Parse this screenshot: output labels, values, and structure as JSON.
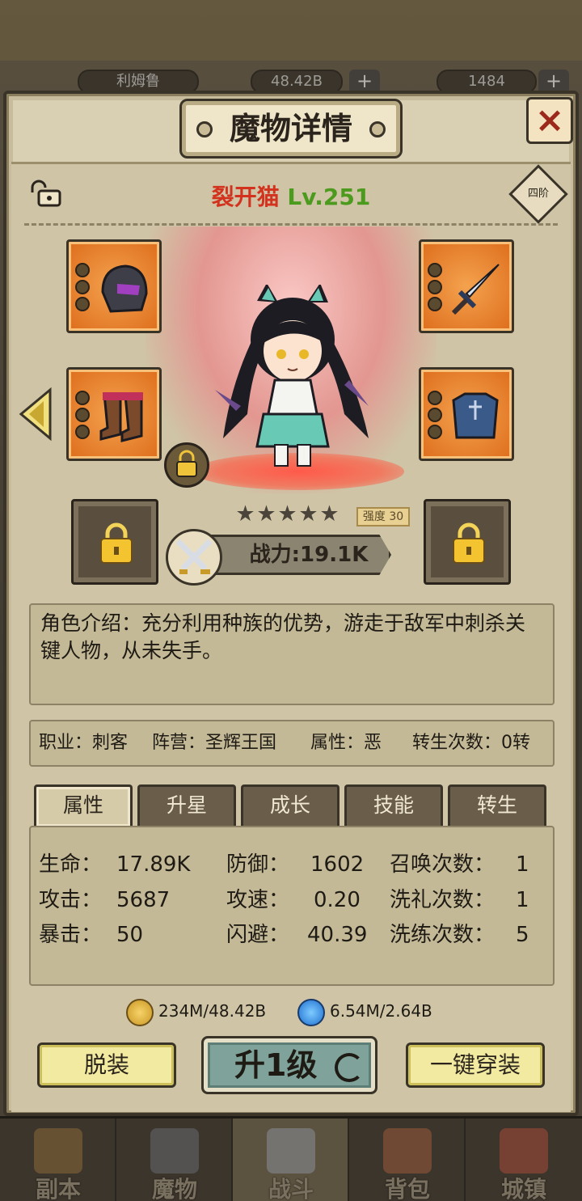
{
  "resources": {
    "player_name": "利姆鲁",
    "gold": "48.42B",
    "gems": "1484",
    "plus": "+"
  },
  "panel": {
    "title": "魔物详情",
    "close": "×"
  },
  "monster": {
    "name": "裂开猫",
    "level": "Lv.251",
    "tier": "四阶",
    "stars": 5,
    "strength_label": "强度",
    "strength_value": "30",
    "power": "战力:19.1K",
    "intro": "角色介绍：充分利用种族的优势，游走于敌军中刺杀关键人物，从未失手。"
  },
  "info": {
    "job": "职业：刺客",
    "camp": "阵营：圣辉王国",
    "attr": "属性：恶",
    "rebirth": "转生次数：0转"
  },
  "tabs": [
    {
      "label": "属性",
      "active": true
    },
    {
      "label": "升星",
      "active": false
    },
    {
      "label": "成长",
      "active": false
    },
    {
      "label": "技能",
      "active": false
    },
    {
      "label": "转生",
      "active": false
    }
  ],
  "stats": {
    "hp_label": "生命：",
    "hp": "17.89K",
    "def_label": "防御：",
    "def": "1602",
    "summon_label": "召唤次数：",
    "summon": "1",
    "atk_label": "攻击：",
    "atk": "5687",
    "aspd_label": "攻速：",
    "aspd": "0.20",
    "baptize_label": "洗礼次数：",
    "baptize": "1",
    "crit_label": "暴击：",
    "crit": "50",
    "dodge_label": "闪避：",
    "dodge": "40.39",
    "refine_label": "洗练次数：",
    "refine": "5"
  },
  "costs": {
    "gold": "234M/48.42B",
    "gem": "6.54M/2.64B"
  },
  "buttons": {
    "unequip": "脱装",
    "level_up": "升1级",
    "equip_all": "一键穿装"
  },
  "nav": [
    {
      "label": "副本",
      "icon": "map-icon",
      "active": false
    },
    {
      "label": "魔物",
      "icon": "monster-icon",
      "active": false
    },
    {
      "label": "战斗",
      "icon": "swords-icon",
      "active": true
    },
    {
      "label": "背包",
      "icon": "backpack-icon",
      "active": false
    },
    {
      "label": "城镇",
      "icon": "town-icon",
      "active": false
    }
  ],
  "colors": {
    "name": "#d2321e",
    "level": "#4c9a1e",
    "equip_bg": "#dd6d1c"
  }
}
